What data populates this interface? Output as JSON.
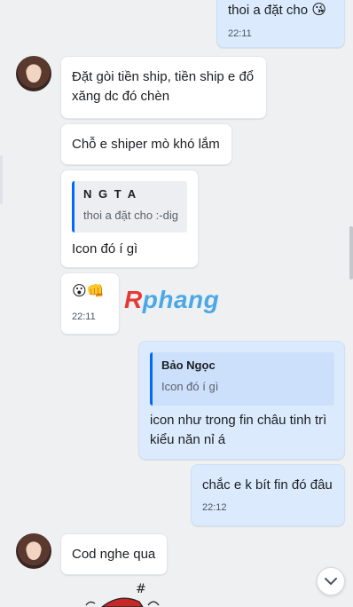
{
  "messages": {
    "m1": {
      "text": "thoi a đặt cho",
      "emoji": "😘",
      "time": "22:11"
    },
    "m2": {
      "text": "Đặt gòi tiền ship, tiền ship e đổ xăng dc đó chèn"
    },
    "m3": {
      "text": "Chỗ e shiper mò khó lắm"
    },
    "m4": {
      "quote_name": "N G T A",
      "quote_text": "thoi a đặt cho :-dig",
      "text": "Icon đó í gì"
    },
    "m5": {
      "emoji": "😮👊",
      "time": "22:11"
    },
    "m6": {
      "quote_name": "Bảo Ngọc",
      "quote_text": "Icon đó í gì",
      "text": "icon như trong fin châu tinh trì kiểu năn nỉ á"
    },
    "m7": {
      "text": "chắc e k bít fin đó đâu",
      "time": "22:12"
    },
    "m8": {
      "text": "Cod nghe qua"
    }
  },
  "watermark": {
    "r": "R",
    "rest": "phang"
  },
  "icons": {
    "scroll_down": "chevron-down-icon"
  }
}
